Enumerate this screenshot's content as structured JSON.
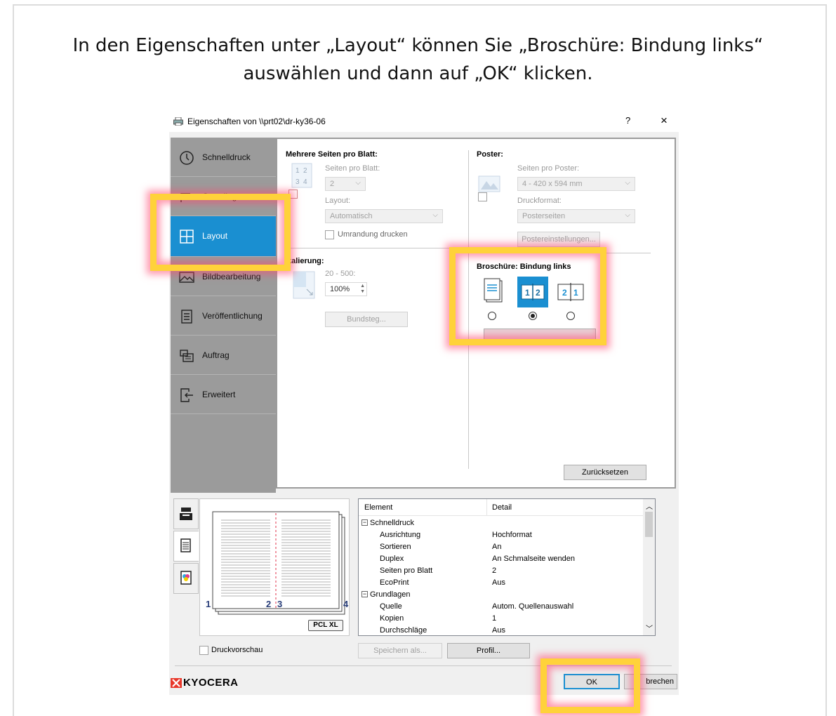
{
  "instruction": {
    "line1": "In den Eigenschaften unter „Layout“ können Sie „Broschüre: Bindung links“",
    "line2": "auswählen und dann auf „OK“ klicken."
  },
  "dialog": {
    "title": "Eigenschaften von \\\\prt02\\dr-ky36-06",
    "help_label": "?",
    "close_label": "×"
  },
  "sidebar": {
    "items": [
      {
        "label": "Schnelldruck",
        "icon": "clock-icon"
      },
      {
        "label": "Grundlagen",
        "icon": "paper-icon"
      },
      {
        "label": "Layout",
        "icon": "grid-icon"
      },
      {
        "label": "Bildbearbeitung",
        "icon": "image-icon"
      },
      {
        "label": "Veröffentlichung",
        "icon": "document-icon"
      },
      {
        "label": "Auftrag",
        "icon": "job-icon"
      },
      {
        "label": "Erweitert",
        "icon": "exit-icon"
      }
    ],
    "active": "Layout"
  },
  "layout": {
    "multipage_title": "Mehrere Seiten pro Blatt:",
    "pages_per_sheet_label": "Seiten pro Blatt:",
    "pages_per_sheet_value": "2",
    "layout_label": "Layout:",
    "layout_value": "Automatisch",
    "border_label": "Umrandung drucken",
    "scaling_title": "kalierung:",
    "scaling_range": "20 - 500:",
    "scaling_value": "100%",
    "gutter_button": "Bundsteg...",
    "poster_title": "Poster:",
    "pages_per_poster_label": "Seiten pro Poster:",
    "pages_per_poster_value": "4 - 420 x 594 mm",
    "print_format_label": "Druckformat:",
    "print_format_value": "Posterseiten",
    "poster_settings_button": "Postereinstellungen...",
    "booklet_label": "Broschüre:",
    "booklet_value": "Bindung links",
    "booklet_icon_left": "1 2",
    "booklet_icon_right": "2 1",
    "reset_button": "Zurücksetzen"
  },
  "preview": {
    "page_numbers": [
      "1",
      "2",
      "3",
      "4"
    ],
    "pdl_badge": "PCL XL",
    "print_preview_label": "Druckvorschau"
  },
  "details": {
    "col_element": "Element",
    "col_detail": "Detail",
    "rows": [
      {
        "element": "Schnelldruck",
        "detail": "",
        "group": true
      },
      {
        "element": "Ausrichtung",
        "detail": "Hochformat",
        "group": false
      },
      {
        "element": "Sortieren",
        "detail": "An",
        "group": false
      },
      {
        "element": "Duplex",
        "detail": "An Schmalseite wenden",
        "group": false
      },
      {
        "element": "Seiten pro Blatt",
        "detail": "2",
        "group": false
      },
      {
        "element": "EcoPrint",
        "detail": "Aus",
        "group": false
      },
      {
        "element": "Grundlagen",
        "detail": "",
        "group": true
      },
      {
        "element": "Quelle",
        "detail": "Autom. Quellenauswahl",
        "group": false
      },
      {
        "element": "Kopien",
        "detail": "1",
        "group": false
      },
      {
        "element": "Durchschläge",
        "detail": "Aus",
        "group": false
      }
    ]
  },
  "footer": {
    "save_as_button": "Speichern als...",
    "profile_button": "Profil...",
    "ok_button": "OK",
    "cancel_button": "brechen",
    "brand": "KYOCERA"
  },
  "colors": {
    "accent": "#1a8fd1",
    "highlight": "#ffd23a",
    "brand_red": "#e8382b"
  }
}
